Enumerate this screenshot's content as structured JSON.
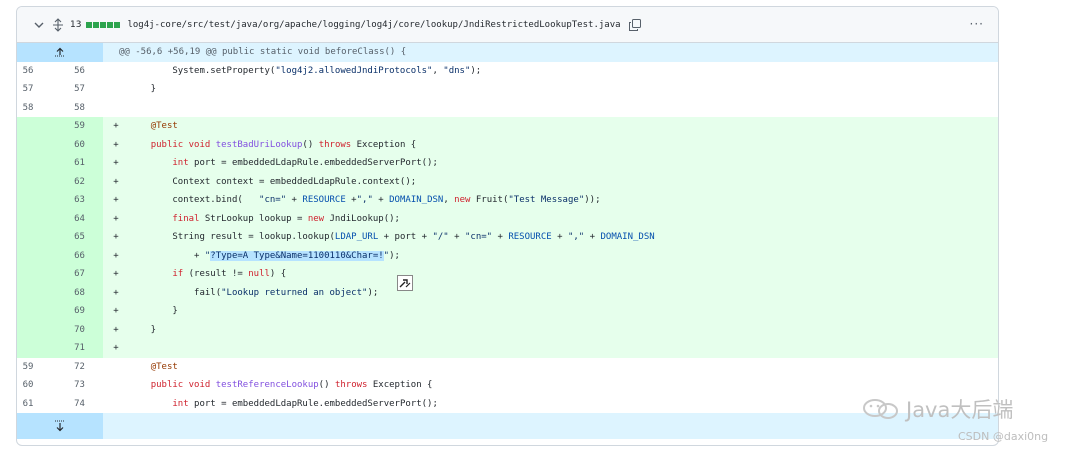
{
  "file_header": {
    "change_count": "13",
    "path": "log4j-core/src/test/java/org/apache/logging/log4j/core/lookup/JndiRestrictedLookupTest.java",
    "more_label": "···"
  },
  "hunk_header": "@@ -56,6 +56,19 @@ public static void beforeClass() {",
  "watermark": {
    "text": "Java大后端"
  },
  "credit": "CSDN @daxi0ng",
  "colors": {
    "added_bg": "#e6ffec",
    "added_gutter": "#ccffd8",
    "hunk_bg": "#ddf4ff",
    "diffstat": "#2da44e"
  }
}
